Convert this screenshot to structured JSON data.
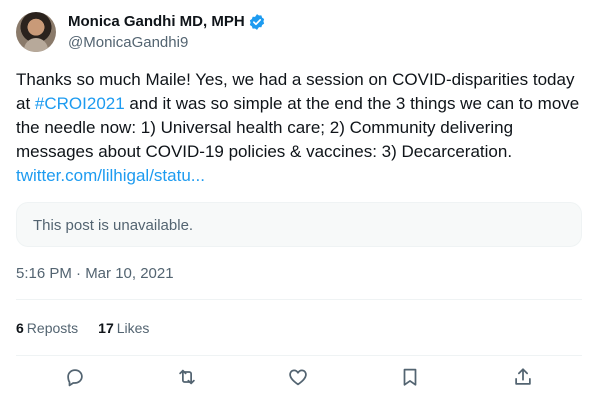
{
  "author": {
    "display_name": "Monica Gandhi MD, MPH",
    "handle": "@MonicaGandhi9",
    "verified": true
  },
  "tweet": {
    "text_part1": "Thanks so much Maile!  Yes, we had a session on COVID-disparities today at ",
    "hashtag": "#CROI2021",
    "text_part2": " and it was so simple at the end the 3 things we can to move the needle now: 1) Universal health care; 2) Community delivering messages about COVID-19 policies & vaccines: 3) Decarceration. ",
    "link": "twitter.com/lilhigal/statu..."
  },
  "quote": {
    "unavailable_text": "This post is unavailable."
  },
  "timestamp": "5:16 PM · Mar 10, 2021",
  "stats": {
    "reposts_count": "6",
    "reposts_label": "Reposts",
    "likes_count": "17",
    "likes_label": "Likes"
  },
  "actions": [
    "reply-icon",
    "repost-icon",
    "like-icon",
    "bookmark-icon",
    "share-icon"
  ],
  "colors": {
    "link": "#1d9bf0",
    "secondary_text": "#536471",
    "verified_badge": "#1d9bf0"
  }
}
